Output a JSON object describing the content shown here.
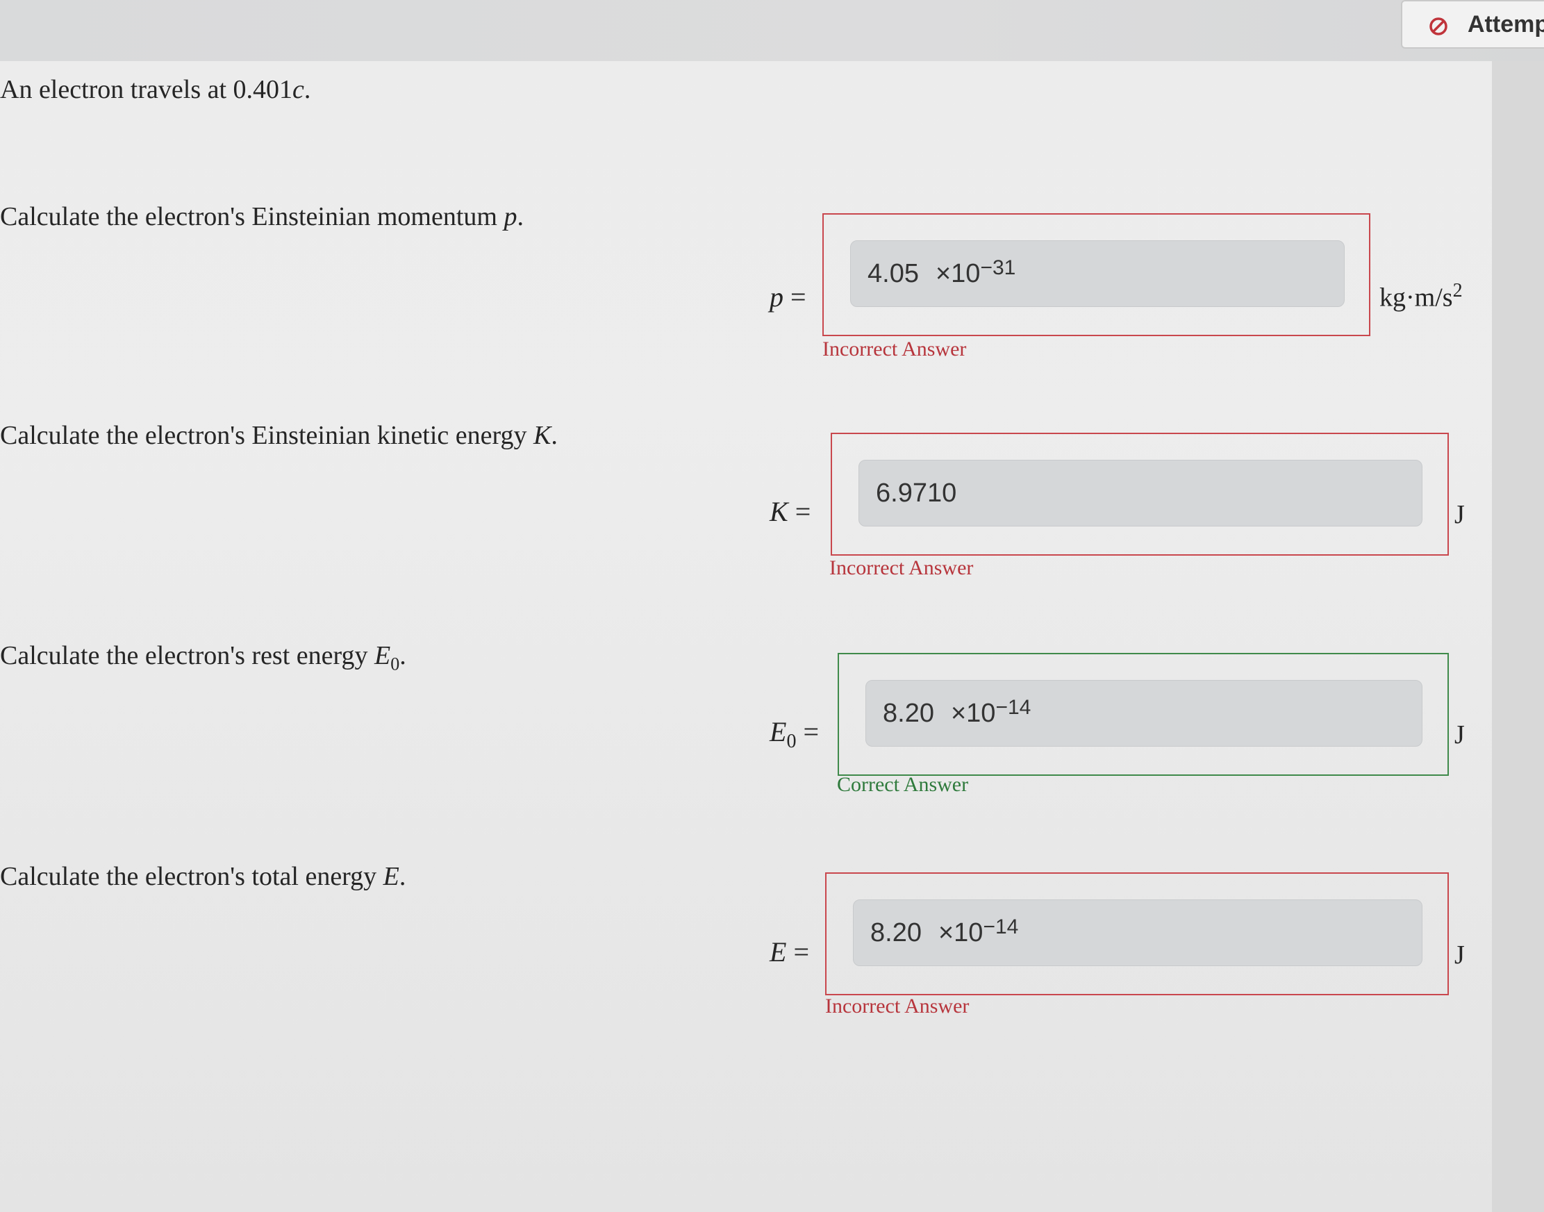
{
  "header": {
    "attempt_label": "Attemp"
  },
  "problem": {
    "intro_prefix": "An electron travels at 0.401",
    "intro_var": "c",
    "intro_suffix": "."
  },
  "questions": [
    {
      "prompt_prefix": "Calculate the electron's Einsteinian momentum ",
      "prompt_var": "p",
      "prompt_suffix": ".",
      "label_var": "p",
      "label_sub": "",
      "label_eq": " =",
      "mantissa": "4.05",
      "times": "×10",
      "exponent": "−31",
      "unit": "kg·m/s",
      "unit_sup": "2",
      "feedback": "Incorrect Answer",
      "status": "incorrect"
    },
    {
      "prompt_prefix": "Calculate the electron's Einsteinian kinetic energy ",
      "prompt_var": "K",
      "prompt_suffix": ".",
      "label_var": "K",
      "label_sub": "",
      "label_eq": " =",
      "mantissa": "6.9710",
      "times": "",
      "exponent": "",
      "unit": "J",
      "unit_sup": "",
      "feedback": "Incorrect Answer",
      "status": "incorrect"
    },
    {
      "prompt_prefix": "Calculate the electron's rest energy ",
      "prompt_var": "E",
      "prompt_sub": "0",
      "prompt_suffix": ".",
      "label_var": "E",
      "label_sub": "0",
      "label_eq": " =",
      "mantissa": "8.20",
      "times": "×10",
      "exponent": "−14",
      "unit": "J",
      "unit_sup": "",
      "feedback": "Correct Answer",
      "status": "correct"
    },
    {
      "prompt_prefix": "Calculate the electron's total energy ",
      "prompt_var": "E",
      "prompt_suffix": ".",
      "label_var": "E",
      "label_sub": "",
      "label_eq": " =",
      "mantissa": "8.20",
      "times": "×10",
      "exponent": "−14",
      "unit": "J",
      "unit_sup": "",
      "feedback": "Incorrect Answer",
      "status": "incorrect"
    }
  ],
  "colors": {
    "incorrect": "#c9474d",
    "correct": "#3f8a4a"
  }
}
